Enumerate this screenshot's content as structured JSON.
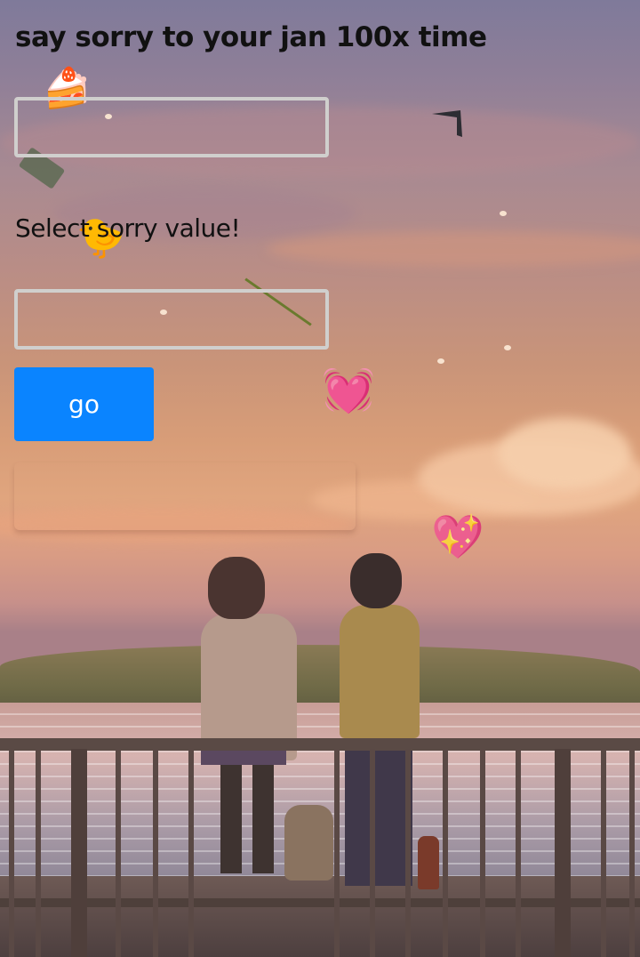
{
  "page": {
    "title": "say sorry to your jan 100x time",
    "select_label": "Select sorry value!",
    "go_button_label": "go",
    "name_input": {
      "value": "",
      "placeholder": ""
    },
    "count_input": {
      "value": "",
      "placeholder": ""
    }
  },
  "colors": {
    "go_button": "#0a84ff",
    "input_border": "#d0cfcd",
    "text": "#111111"
  },
  "icons": [
    "cake-icon",
    "chick-icon",
    "heart-icon",
    "sparkling-heart-icon",
    "bird-icon"
  ]
}
